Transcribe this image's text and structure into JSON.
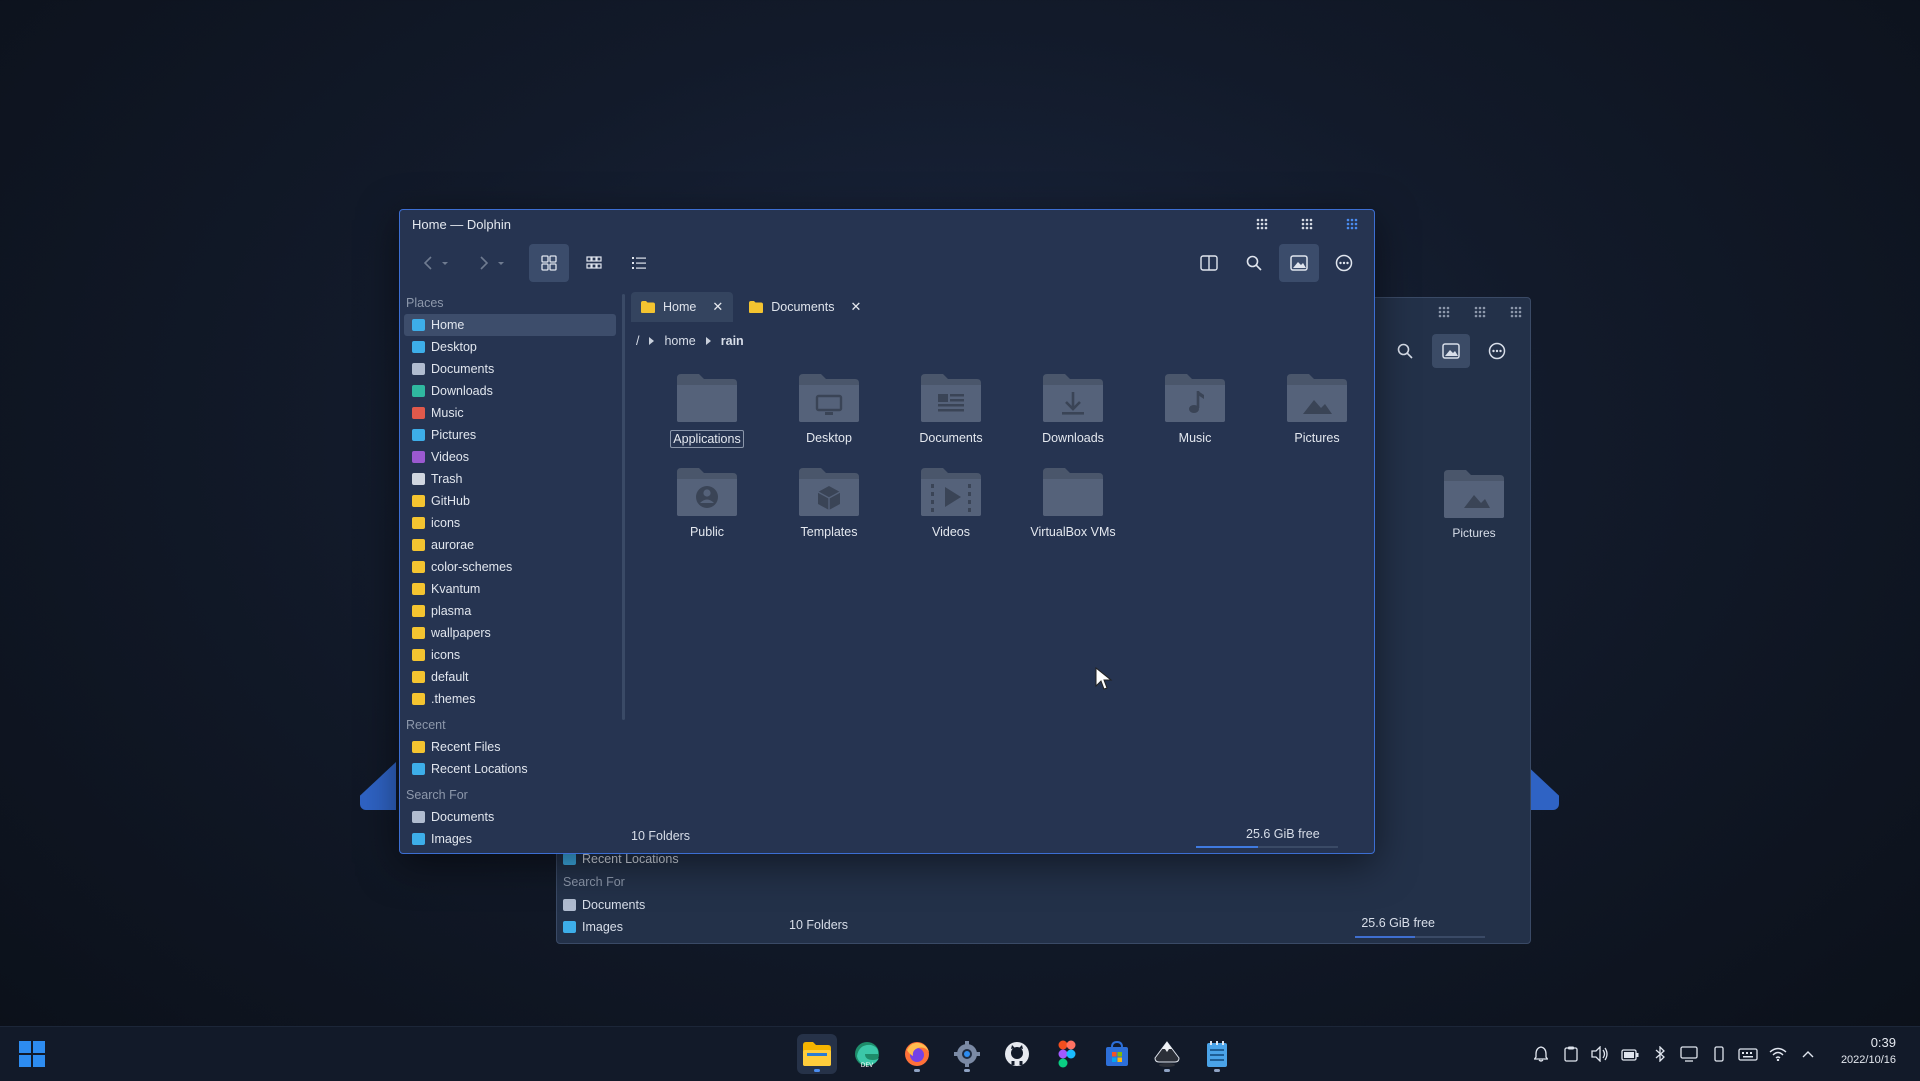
{
  "window": {
    "title": "Home — Dolphin"
  },
  "tabs": [
    {
      "label": "Home"
    },
    {
      "label": "Documents"
    }
  ],
  "breadcrumb": {
    "root": "/",
    "items": [
      "home",
      "rain"
    ]
  },
  "sidebar": {
    "places_header": "Places",
    "places": [
      {
        "label": "Home",
        "icon": "home-icon",
        "color": "#3daee9"
      },
      {
        "label": "Desktop",
        "icon": "desktop-icon",
        "color": "#3daee9"
      },
      {
        "label": "Documents",
        "icon": "document-icon",
        "color": "#b0bcd0"
      },
      {
        "label": "Downloads",
        "icon": "download-icon",
        "color": "#2fb8a0"
      },
      {
        "label": "Music",
        "icon": "music-icon",
        "color": "#e0594b"
      },
      {
        "label": "Pictures",
        "icon": "picture-icon",
        "color": "#3daee9"
      },
      {
        "label": "Videos",
        "icon": "video-icon",
        "color": "#9b59d0"
      },
      {
        "label": "Trash",
        "icon": "trash-icon",
        "color": "#d0d6e0"
      },
      {
        "label": "GitHub",
        "icon": "folder-icon",
        "color": "#f4c430"
      },
      {
        "label": "icons",
        "icon": "folder-icon",
        "color": "#f4c430"
      },
      {
        "label": "aurorae",
        "icon": "folder-icon",
        "color": "#f4c430"
      },
      {
        "label": "color-schemes",
        "icon": "folder-icon",
        "color": "#f4c430"
      },
      {
        "label": "Kvantum",
        "icon": "folder-icon",
        "color": "#f4c430"
      },
      {
        "label": "plasma",
        "icon": "folder-icon",
        "color": "#f4c430"
      },
      {
        "label": "wallpapers",
        "icon": "folder-icon",
        "color": "#f4c430"
      },
      {
        "label": "icons",
        "icon": "folder-icon",
        "color": "#f4c430"
      },
      {
        "label": "default",
        "icon": "folder-icon",
        "color": "#f4c430"
      },
      {
        "label": ".themes",
        "icon": "folder-icon",
        "color": "#f4c430"
      }
    ],
    "recent_header": "Recent",
    "recent": [
      {
        "label": "Recent Files",
        "icon": "recent-files-icon",
        "color": "#f4c430"
      },
      {
        "label": "Recent Locations",
        "icon": "recent-locations-icon",
        "color": "#3daee9"
      }
    ],
    "search_header": "Search For",
    "search": [
      {
        "label": "Documents",
        "icon": "document-icon",
        "color": "#b0bcd0"
      },
      {
        "label": "Images",
        "icon": "picture-icon",
        "color": "#3daee9"
      }
    ]
  },
  "folders": [
    {
      "label": "Applications",
      "glyph": "none"
    },
    {
      "label": "Desktop",
      "glyph": "desktop"
    },
    {
      "label": "Documents",
      "glyph": "documents"
    },
    {
      "label": "Downloads",
      "glyph": "download"
    },
    {
      "label": "Music",
      "glyph": "music"
    },
    {
      "label": "Pictures",
      "glyph": "pictures"
    },
    {
      "label": "Public",
      "glyph": "public"
    },
    {
      "label": "Templates",
      "glyph": "templates"
    },
    {
      "label": "Videos",
      "glyph": "videos"
    },
    {
      "label": "VirtualBox VMs",
      "glyph": "none"
    }
  ],
  "status": {
    "count": "10 Folders",
    "free": "25.6 GiB free",
    "used_fraction": 0.44
  },
  "background_window": {
    "folder_label": "Pictures",
    "recent_locations": "Recent Locations",
    "search_header": "Search For",
    "search_documents": "Documents",
    "search_images": "Images",
    "count": "10 Folders",
    "free": "25.6 GiB free"
  },
  "taskbar": {
    "apps": [
      "file-manager-icon",
      "edge-dev-icon",
      "firefox-icon",
      "settings-icon",
      "github-icon",
      "figma-icon",
      "store-icon",
      "inkscape-icon",
      "notes-icon"
    ],
    "time": "0:39",
    "date": "2022/10/16"
  },
  "colors": {
    "accent": "#3c6ed2",
    "window_bg": "#263451",
    "folder": "#4a566b"
  }
}
